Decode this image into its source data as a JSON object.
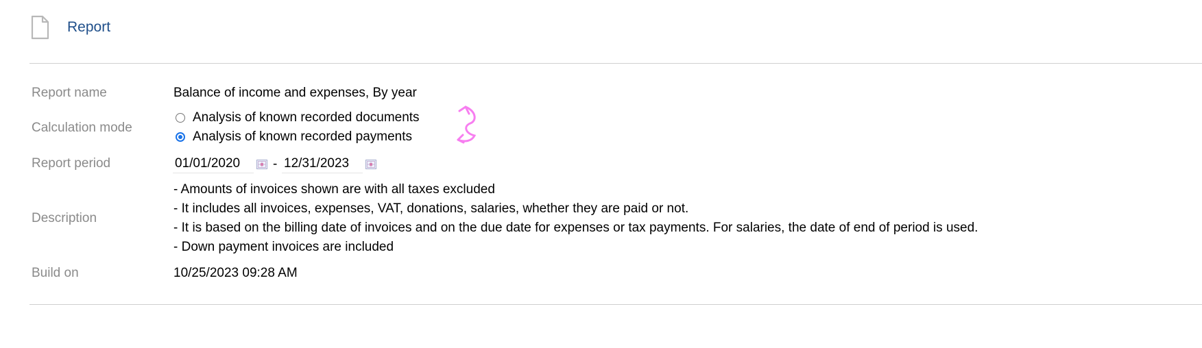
{
  "header": {
    "icon": "document-icon",
    "title": "Report"
  },
  "report": {
    "name_label": "Report name",
    "name_value": "Balance of income and expenses, By year",
    "mode_label": "Calculation mode",
    "mode_options": [
      {
        "label": "Analysis of known recorded documents",
        "checked": false
      },
      {
        "label": "Analysis of known recorded payments",
        "checked": true
      }
    ],
    "period_label": "Report period",
    "period_start": "01/01/2020",
    "period_separator": "-",
    "period_end": "12/31/2023",
    "description_label": "Description",
    "description_lines": [
      "- Amounts of invoices shown are with all taxes excluded",
      "- It includes all invoices, expenses, VAT, donations, salaries, whether they are paid or not.",
      "- It is based on the billing date of invoices and on the due date for expenses or tax payments. For salaries, the date of end of period is used.",
      "- Down payment invoices are included"
    ],
    "build_label": "Build on",
    "build_value": "10/25/2023 09:28 AM"
  },
  "colors": {
    "title": "#1f4f8a",
    "label": "#8a8a8a",
    "radio_checked": "#1a73e8",
    "annotation": "#f77ef0"
  }
}
